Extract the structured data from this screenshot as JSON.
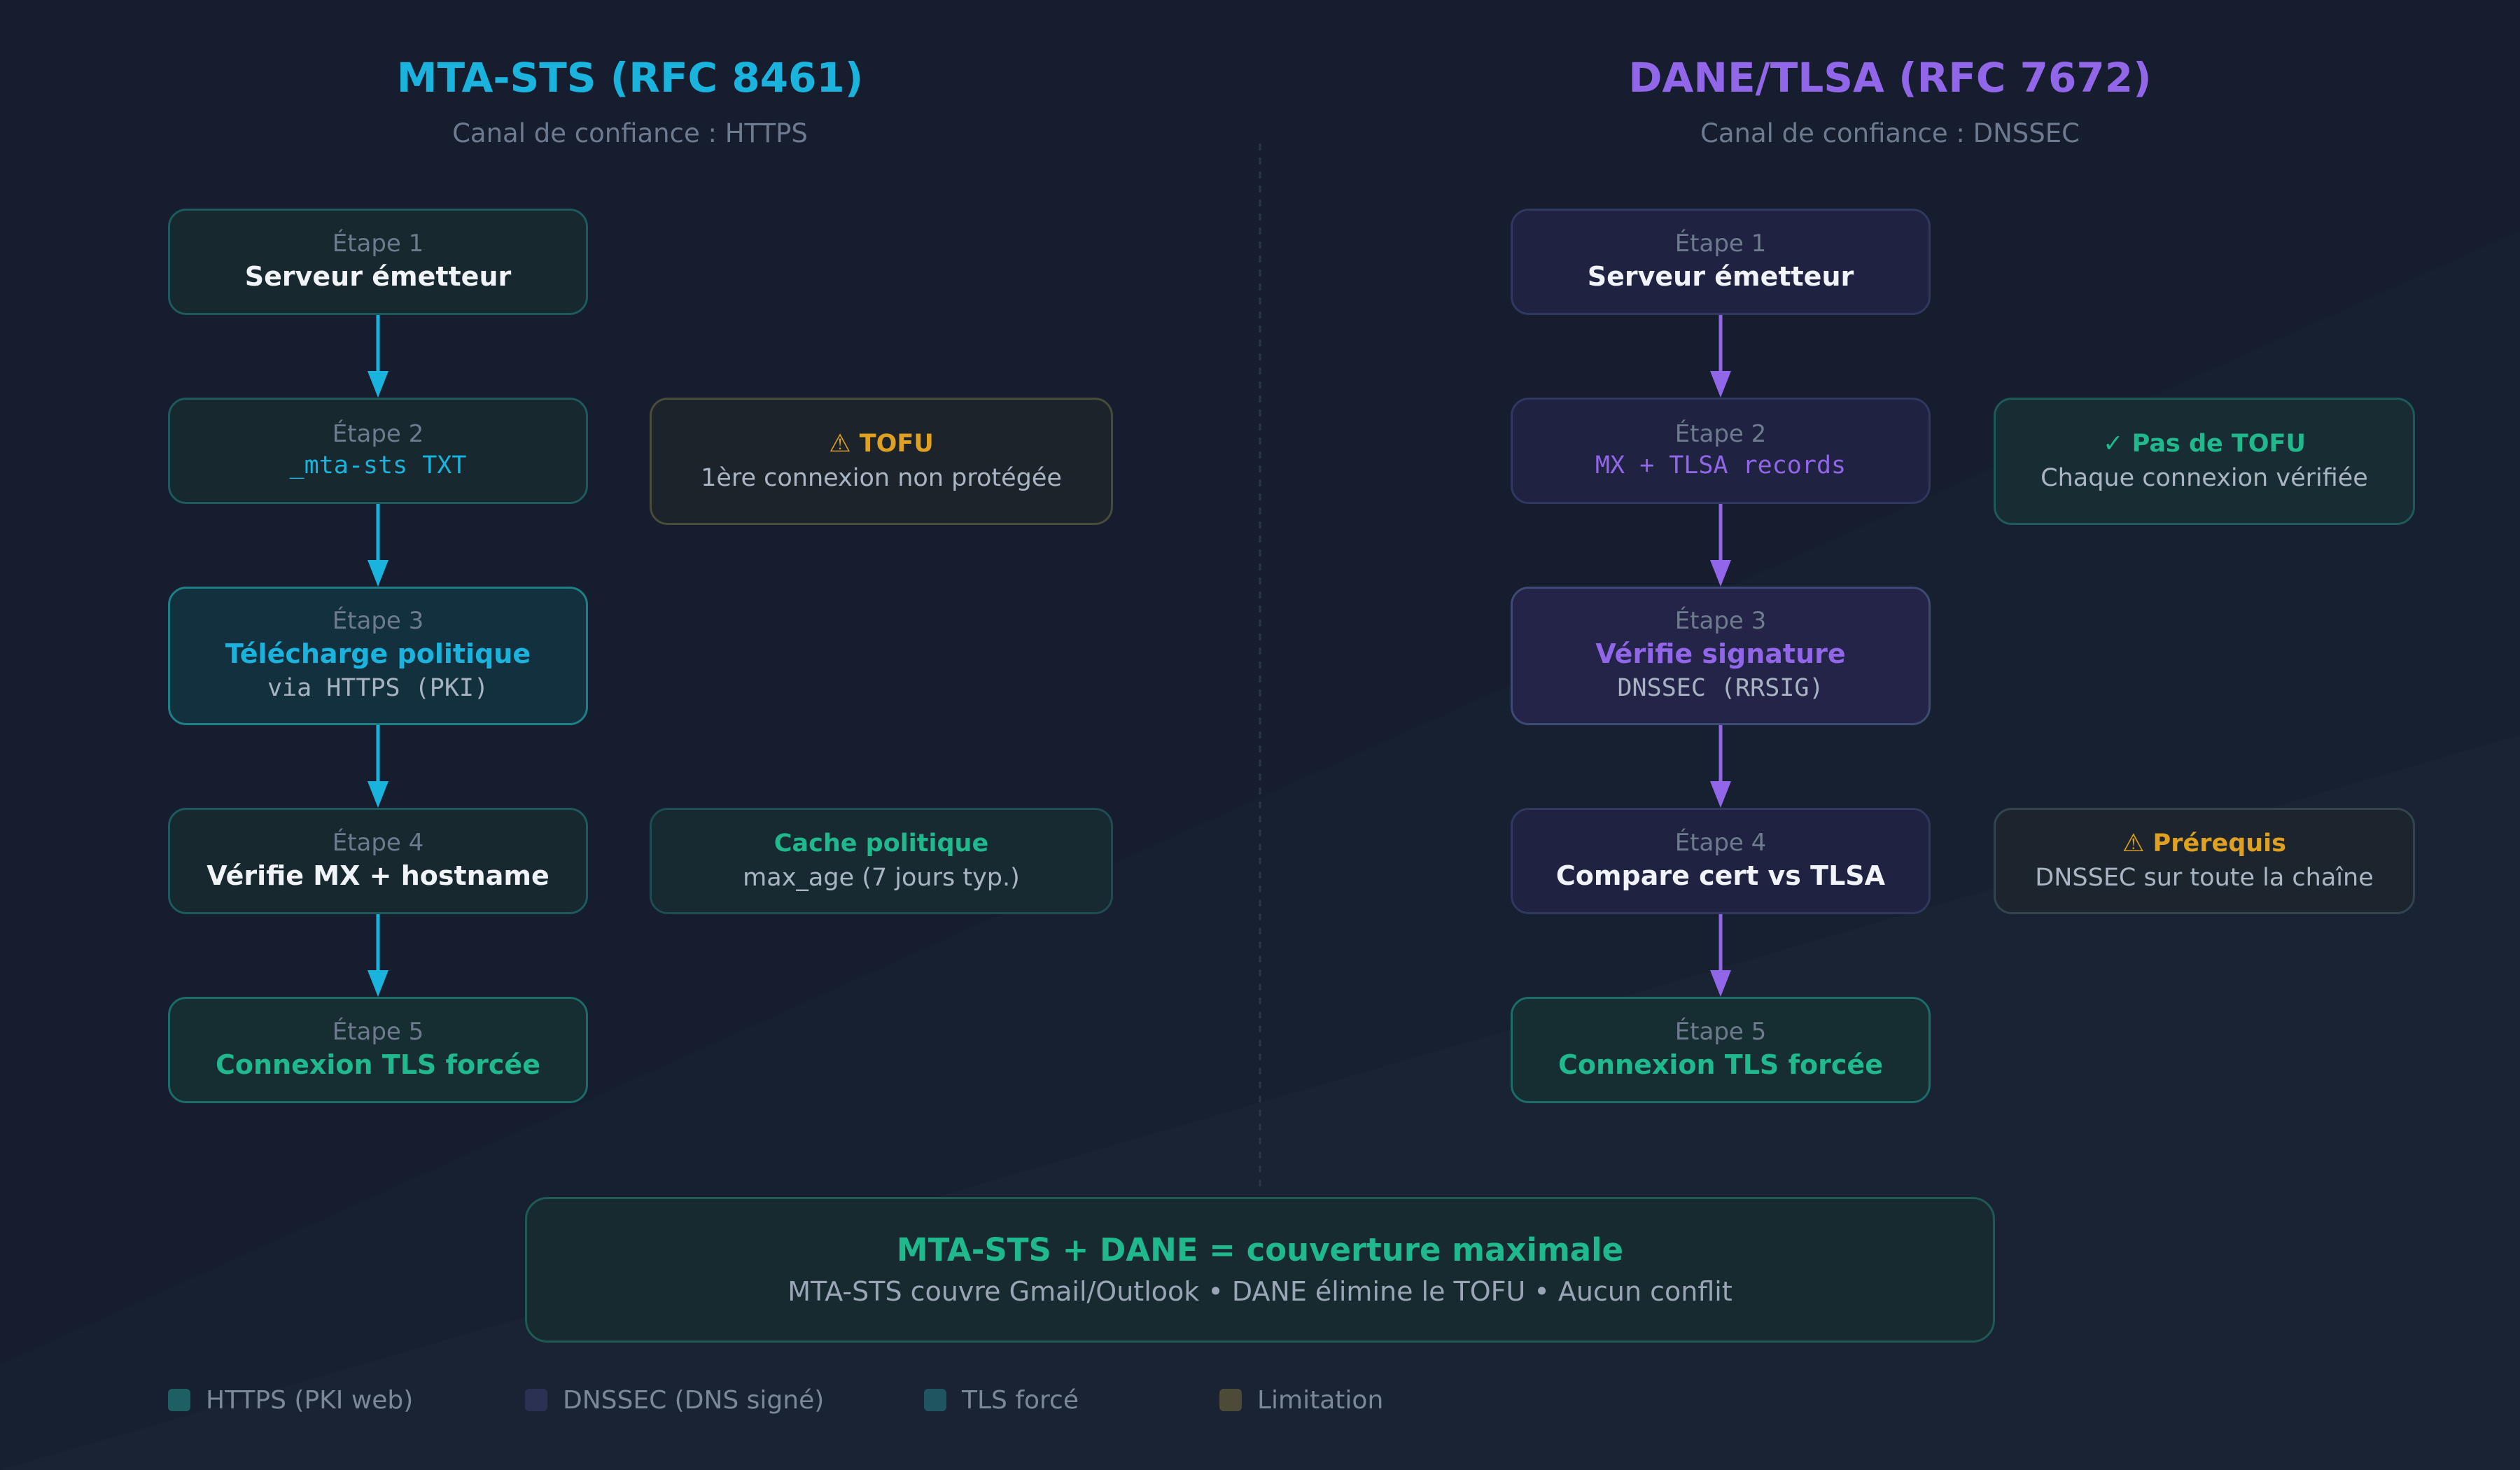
{
  "colors": {
    "sts_accent": "#1ab3dd",
    "dane_accent": "#9166e8",
    "success": "#1fb98d",
    "warning": "#e0a020"
  },
  "mta_sts": {
    "title": "MTA-STS (RFC 8461)",
    "subtitle": "Canal de confiance : HTTPS",
    "steps": [
      {
        "label": "Étape 1",
        "main": "Serveur émetteur"
      },
      {
        "label": "Étape 2",
        "main": "_mta-sts TXT"
      },
      {
        "label": "Étape 3",
        "main": "Télécharge politique",
        "detail": "via HTTPS (PKI)"
      },
      {
        "label": "Étape 4",
        "main": "Vérifie MX + hostname"
      },
      {
        "label": "Étape 5",
        "main": "Connexion TLS forcée"
      }
    ],
    "notes": [
      {
        "icon": "warning-icon",
        "title": "⚠ TOFU",
        "text": "1ère connexion non protégée"
      },
      {
        "title": "Cache politique",
        "text": "max_age (7 jours typ.)"
      }
    ]
  },
  "dane": {
    "title": "DANE/TLSA (RFC 7672)",
    "subtitle": "Canal de confiance : DNSSEC",
    "steps": [
      {
        "label": "Étape 1",
        "main": "Serveur émetteur"
      },
      {
        "label": "Étape 2",
        "main": "MX + TLSA records"
      },
      {
        "label": "Étape 3",
        "main": "Vérifie signature",
        "detail": "DNSSEC (RRSIG)"
      },
      {
        "label": "Étape 4",
        "main": "Compare cert vs TLSA"
      },
      {
        "label": "Étape 5",
        "main": "Connexion TLS forcée"
      }
    ],
    "notes": [
      {
        "icon": "check-icon",
        "title": "✓ Pas de TOFU",
        "text": "Chaque connexion vérifiée"
      },
      {
        "icon": "warning-icon",
        "title": "⚠ Prérequis",
        "text": "DNSSEC sur toute la chaîne"
      }
    ]
  },
  "summary": {
    "title": "MTA-STS + DANE = couverture maximale",
    "text": "MTA-STS couvre Gmail/Outlook • DANE élimine le TOFU • Aucun conflit"
  },
  "legend": [
    {
      "label": "HTTPS (PKI web)",
      "color": "#1e5f63"
    },
    {
      "label": "DNSSEC (DNS signé)",
      "color": "#2a3152"
    },
    {
      "label": "TLS forcé",
      "color": "#1e5560"
    },
    {
      "label": "Limitation",
      "color": "#4d4a37"
    }
  ]
}
